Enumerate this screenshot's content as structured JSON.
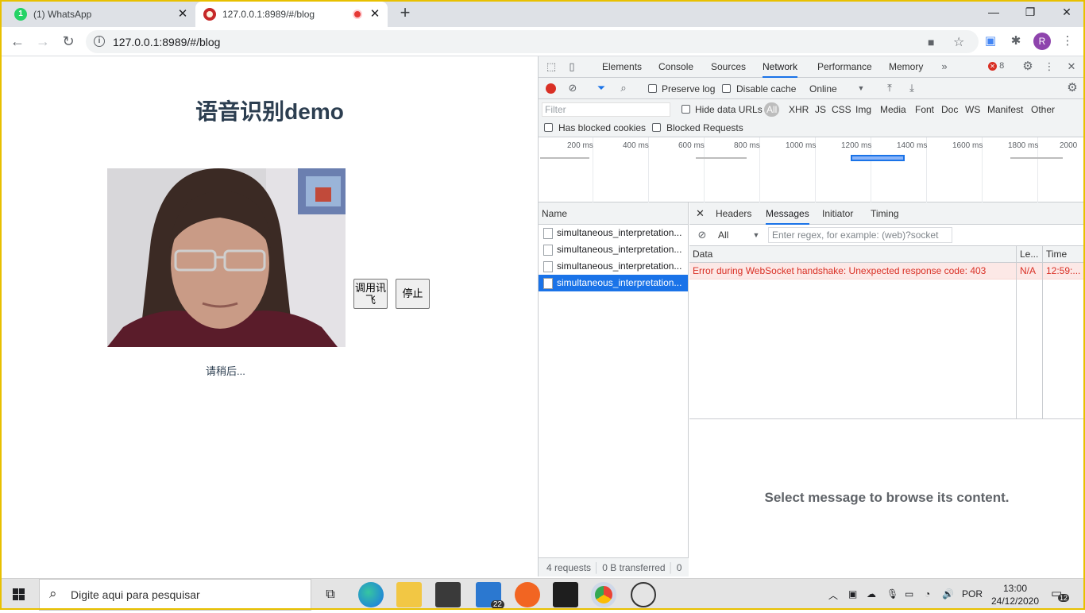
{
  "browser": {
    "tabs": [
      {
        "title": "(1) WhatsApp",
        "badge": "1"
      },
      {
        "title": "127.0.0.1:8989/#/blog"
      }
    ],
    "url": "127.0.0.1:8989/#/blog",
    "profile_initial": "R"
  },
  "page": {
    "heading": "语音识别demo",
    "button_call": "调用讯飞",
    "button_stop": "停止",
    "status": "请稍后..."
  },
  "devtools": {
    "panels": [
      "Elements",
      "Console",
      "Sources",
      "Network",
      "Performance",
      "Memory"
    ],
    "active_panel": "Network",
    "error_count": "8",
    "toolbar": {
      "preserve_log": "Preserve log",
      "disable_cache": "Disable cache",
      "throttle": "Online"
    },
    "filter": {
      "placeholder": "Filter",
      "hide_data_urls": "Hide data URLs",
      "types": [
        "All",
        "XHR",
        "JS",
        "CSS",
        "Img",
        "Media",
        "Font",
        "Doc",
        "WS",
        "Manifest",
        "Other"
      ],
      "has_blocked_cookies": "Has blocked cookies",
      "blocked_requests": "Blocked Requests"
    },
    "timeline_ticks": [
      "200 ms",
      "400 ms",
      "600 ms",
      "800 ms",
      "1000 ms",
      "1200 ms",
      "1400 ms",
      "1600 ms",
      "1800 ms",
      "2000"
    ],
    "name_header": "Name",
    "requests": [
      "simultaneous_interpretation...",
      "simultaneous_interpretation...",
      "simultaneous_interpretation...",
      "simultaneous_interpretation..."
    ],
    "summary": {
      "requests": "4 requests",
      "transferred": "0 B transferred",
      "extra": "0"
    },
    "detail_tabs": [
      "Headers",
      "Messages",
      "Initiator",
      "Timing"
    ],
    "active_detail_tab": "Messages",
    "message_filter": {
      "type": "All",
      "placeholder": "Enter regex, for example: (web)?socket"
    },
    "message_columns": [
      "Data",
      "Le...",
      "Time"
    ],
    "messages": [
      {
        "data": "Error during WebSocket handshake: Unexpected response code: 403",
        "length": "N/A",
        "time": "12:59:..."
      }
    ],
    "empty_hint": "Select message to browse its content."
  },
  "taskbar": {
    "search_placeholder": "Digite aqui para pesquisar",
    "mail_badge": "22",
    "language": "POR",
    "time": "13:00",
    "date": "24/12/2020",
    "notifications": "12"
  }
}
